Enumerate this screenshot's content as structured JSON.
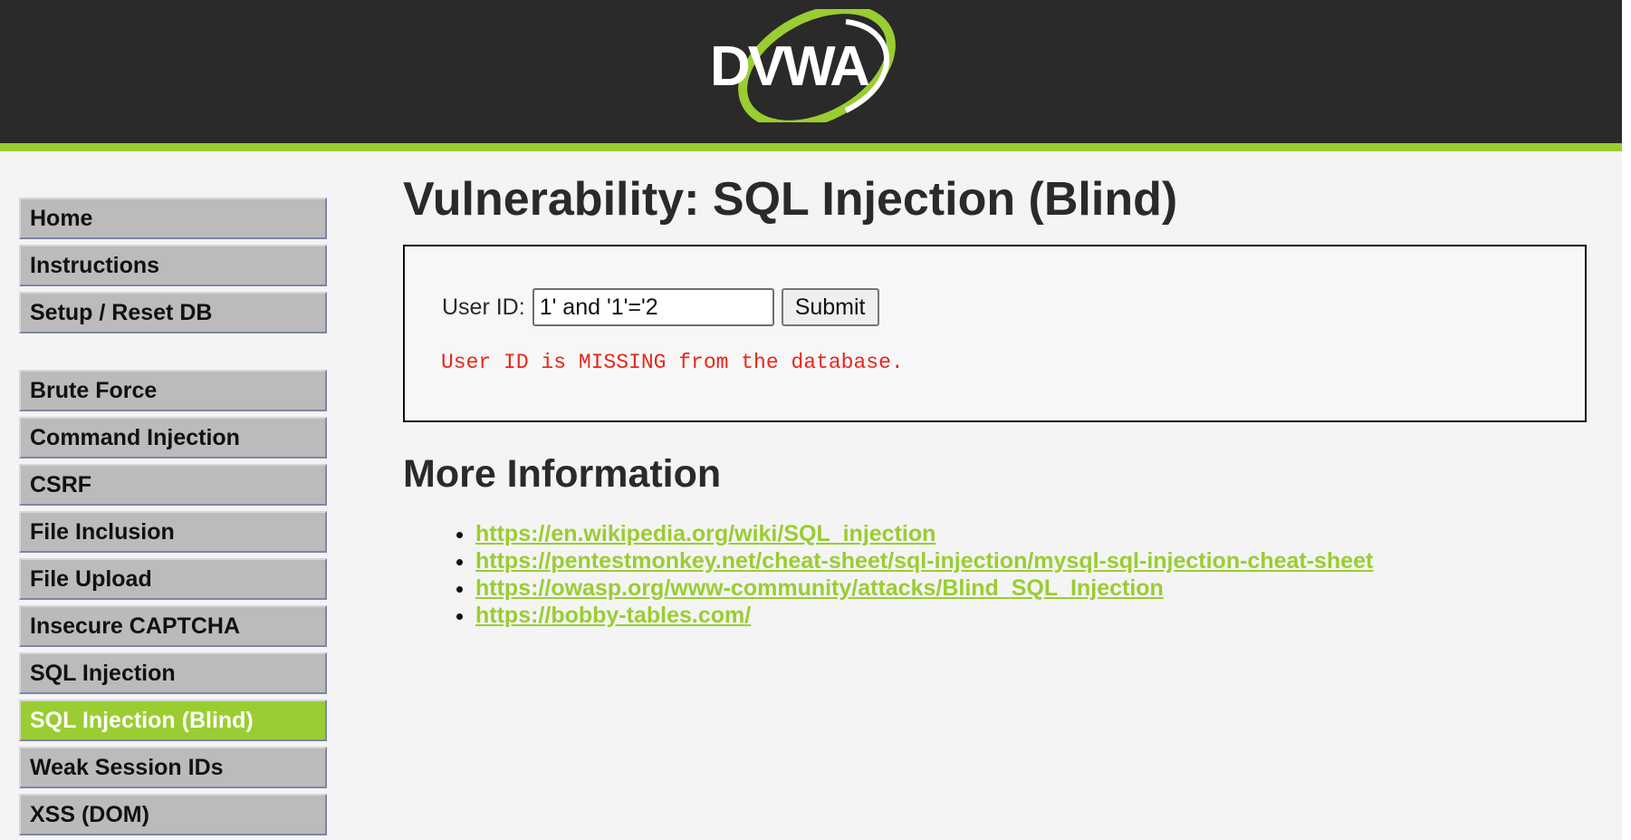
{
  "header": {
    "logo_text": "DVWA"
  },
  "colors": {
    "header_bg": "#2a2a2a",
    "accent": "#9acd32",
    "menu_bg": "#bbbbbb",
    "error": "#e8261c"
  },
  "sidebar": {
    "groups": [
      [
        {
          "label": "Home",
          "selected": false
        },
        {
          "label": "Instructions",
          "selected": false
        },
        {
          "label": "Setup / Reset DB",
          "selected": false
        }
      ],
      [
        {
          "label": "Brute Force",
          "selected": false
        },
        {
          "label": "Command Injection",
          "selected": false
        },
        {
          "label": "CSRF",
          "selected": false
        },
        {
          "label": "File Inclusion",
          "selected": false
        },
        {
          "label": "File Upload",
          "selected": false
        },
        {
          "label": "Insecure CAPTCHA",
          "selected": false
        },
        {
          "label": "SQL Injection",
          "selected": false
        },
        {
          "label": "SQL Injection (Blind)",
          "selected": true
        },
        {
          "label": "Weak Session IDs",
          "selected": false
        },
        {
          "label": "XSS (DOM)",
          "selected": false
        }
      ]
    ]
  },
  "main": {
    "title": "Vulnerability: SQL Injection (Blind)",
    "form": {
      "label": "User ID:",
      "input_value": "1' and '1'='2",
      "submit_label": "Submit"
    },
    "result_message": "User ID is MISSING from the database.",
    "more_info_title": "More Information",
    "links": [
      "https://en.wikipedia.org/wiki/SQL_injection",
      "https://pentestmonkey.net/cheat-sheet/sql-injection/mysql-sql-injection-cheat-sheet",
      "https://owasp.org/www-community/attacks/Blind_SQL_Injection",
      "https://bobby-tables.com/"
    ]
  }
}
